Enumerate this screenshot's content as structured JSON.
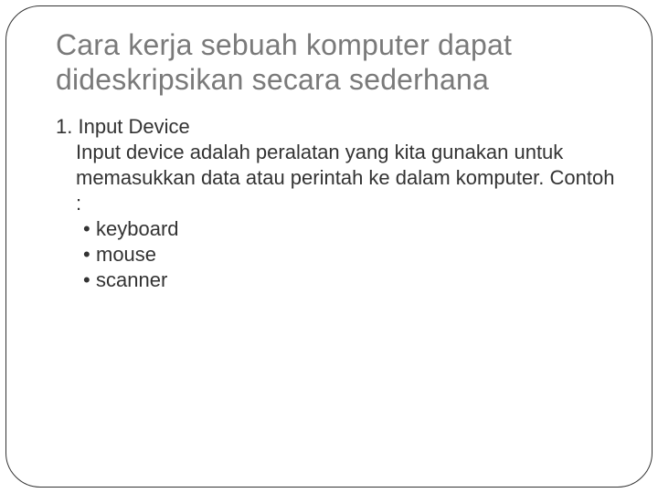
{
  "title": "Cara kerja sebuah komputer dapat dideskripsikan secara sederhana",
  "item": {
    "number": "1.",
    "name": "Input Device",
    "description": "Input device adalah peralatan yang kita gunakan untuk memasukkan data atau perintah ke dalam komputer. Contoh :",
    "bullets": [
      "keyboard",
      "mouse",
      "scanner"
    ]
  }
}
